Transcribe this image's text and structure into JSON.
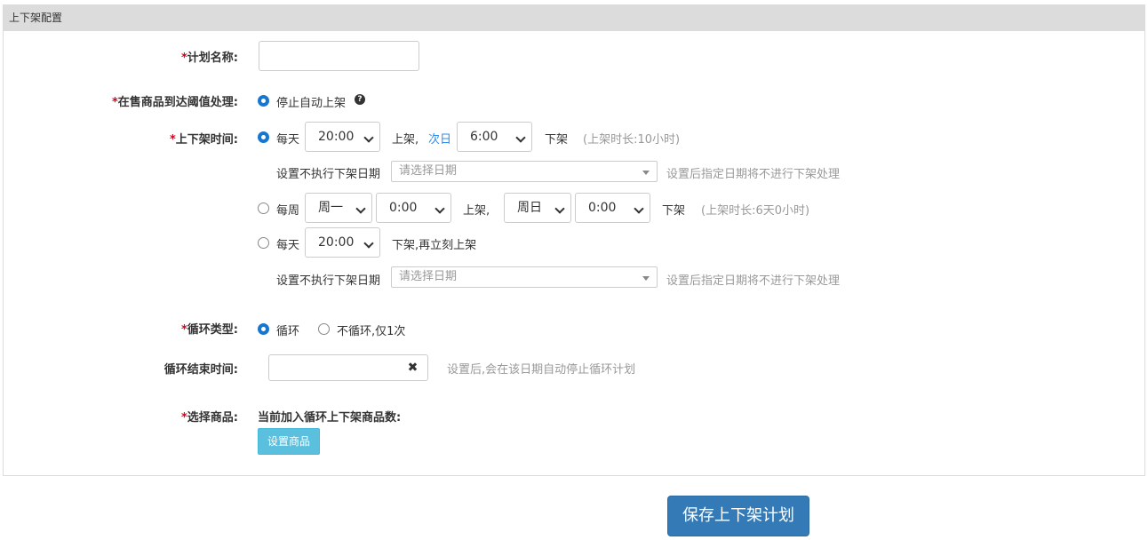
{
  "panel": {
    "title": "上下架配置"
  },
  "plan_name": {
    "label": "计划名称:",
    "value": ""
  },
  "threshold": {
    "label": "在售商品到达阈值处理:",
    "option": "停止自动上架"
  },
  "schedule": {
    "label": "上下架时间:",
    "daily": {
      "prefix": "每天",
      "on_time": "20:00",
      "on_text": "上架,",
      "next_day": "次日",
      "off_time": "6:00",
      "off_text": "下架",
      "duration": "(上架时长:10小时)",
      "exclude_label": "设置不执行下架日期",
      "exclude_placeholder": "请选择日期",
      "exclude_hint": "设置后指定日期将不进行下架处理"
    },
    "weekly": {
      "prefix": "每周",
      "on_day": "周一",
      "on_time": "0:00",
      "on_text": "上架,",
      "off_day": "周日",
      "off_time": "0:00",
      "off_text": "下架",
      "duration": "(上架时长:6天0小时)"
    },
    "daily_relist": {
      "prefix": "每天",
      "time": "20:00",
      "text": "下架,再立刻上架",
      "exclude_label": "设置不执行下架日期",
      "exclude_placeholder": "请选择日期",
      "exclude_hint": "设置后指定日期将不进行下架处理"
    }
  },
  "cycle": {
    "label": "循环类型:",
    "opt_loop": "循环",
    "opt_once": "不循环,仅1次"
  },
  "cycle_end": {
    "label": "循环结束时间:",
    "value": "",
    "clear_icon": "times-icon",
    "hint": "设置后,会在该日期自动停止循环计划"
  },
  "goods": {
    "label": "选择商品:",
    "count_label": "当前加入循环上下架商品数:",
    "button": "设置商品"
  },
  "save_button": "保存上下架计划",
  "colors": {
    "accent": "#1677d2",
    "save": "#337ab7",
    "info": "#5bc0de",
    "required": "#d9001b"
  }
}
